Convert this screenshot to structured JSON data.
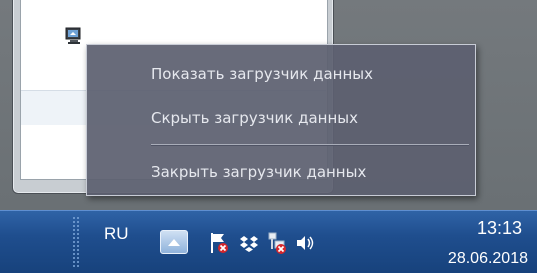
{
  "context_menu": {
    "items": [
      {
        "label": "Показать загрузчик данных"
      },
      {
        "label": "Скрыть загрузчик данных"
      },
      {
        "label": "Закрыть загрузчик данных"
      }
    ]
  },
  "taskbar": {
    "language": "RU",
    "clock": {
      "time": "13:13",
      "date": "28.06.2018"
    },
    "tray_icons": [
      "show-hidden-icons",
      "action-center-flag-icon",
      "dropbox-icon",
      "network-disconnected-icon",
      "volume-icon"
    ]
  },
  "colors": {
    "menu_bg": "#5c6070",
    "menu_text": "#e6e8ee",
    "taskbar": "#1f4e8e"
  }
}
